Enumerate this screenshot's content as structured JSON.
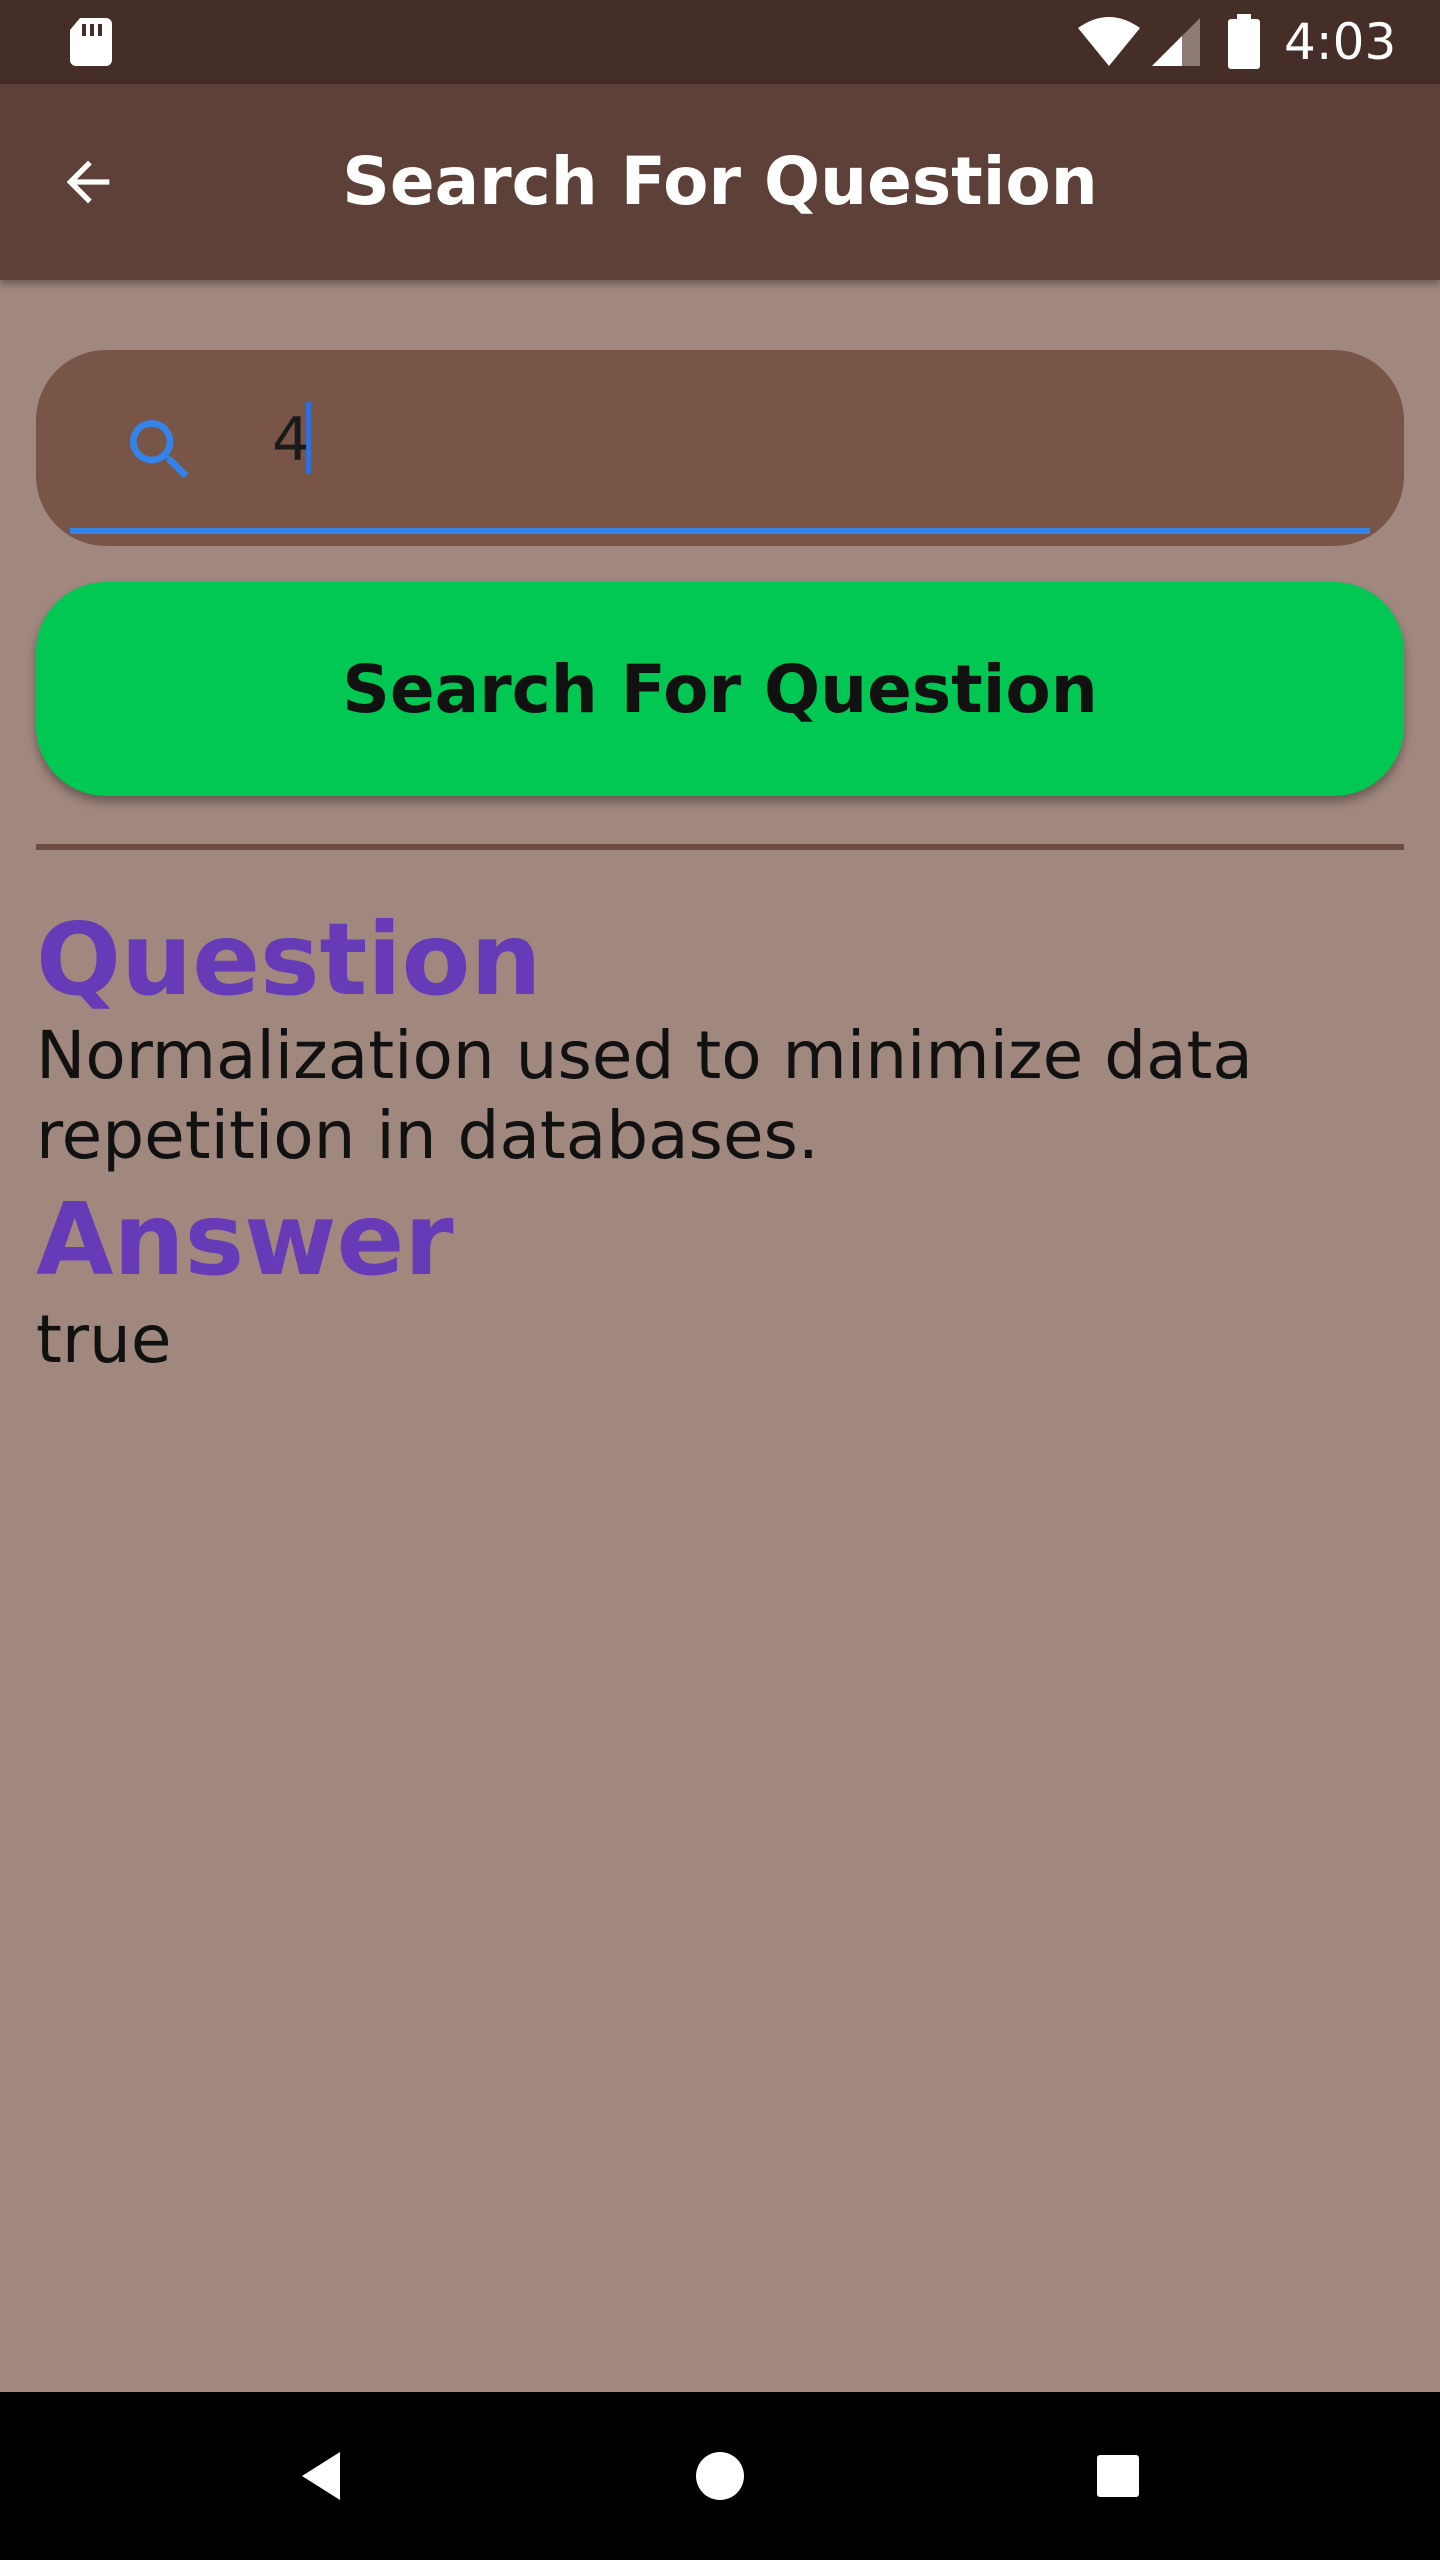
{
  "status_bar": {
    "time": "4:03",
    "icons": [
      "sd-card-icon",
      "wifi-icon",
      "cell-signal-icon",
      "battery-icon"
    ]
  },
  "app_bar": {
    "title": "Search For Question",
    "back_icon": "arrow-back-icon"
  },
  "search": {
    "icon": "search-icon",
    "value": "4",
    "placeholder": ""
  },
  "search_button": {
    "label": "Search For Question"
  },
  "result": {
    "question_heading": "Question",
    "question_text": "Normalization used to minimize data repetition in databases.",
    "answer_heading": "Answer",
    "answer_text": "true"
  },
  "nav_bar": {
    "icons": [
      "nav-back-icon",
      "nav-home-icon",
      "nav-recents-icon"
    ]
  },
  "colors": {
    "status_bar": "#452d28",
    "app_bar": "#5d4037",
    "background": "#a1887f",
    "search_field": "#795548",
    "accent_blue": "#3483e8",
    "button_green": "#00c853",
    "heading_purple": "#673ab7"
  }
}
